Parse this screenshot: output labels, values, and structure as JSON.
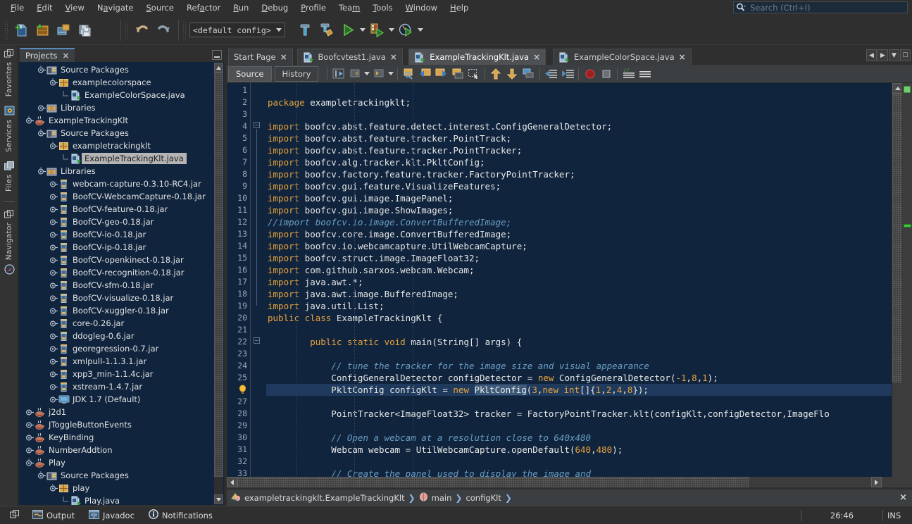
{
  "menubar": {
    "items": [
      "File",
      "Edit",
      "View",
      "Navigate",
      "Source",
      "Refactor",
      "Run",
      "Debug",
      "Profile",
      "Team",
      "Tools",
      "Window",
      "Help"
    ],
    "search_placeholder": "Search (Ctrl+I)",
    "search_value": ""
  },
  "toolbar": {
    "config_value": "<default config>",
    "buttons": [
      {
        "name": "new-file-icon",
        "tooltip": "New File"
      },
      {
        "name": "new-project-icon",
        "tooltip": "New Project"
      },
      {
        "name": "open-project-icon",
        "tooltip": "Open Project"
      },
      {
        "name": "save-all-icon",
        "tooltip": "Save All"
      },
      {
        "name": "undo-icon",
        "tooltip": "Undo"
      },
      {
        "name": "redo-icon",
        "tooltip": "Redo"
      },
      {
        "name": "build-project-icon",
        "tooltip": "Build Project"
      },
      {
        "name": "clean-build-icon",
        "tooltip": "Clean and Build Project"
      },
      {
        "name": "run-project-icon",
        "tooltip": "Run Project"
      },
      {
        "name": "debug-project-icon",
        "tooltip": "Debug Project"
      },
      {
        "name": "profile-project-icon",
        "tooltip": "Profile Project"
      }
    ]
  },
  "left_strip": {
    "items": [
      {
        "label": "Favorites",
        "icon": "favorites-icon"
      },
      {
        "label": "Services",
        "icon": "services-icon"
      },
      {
        "label": "Files",
        "icon": "files-icon"
      },
      {
        "label": "Navigator",
        "icon": "navigator-icon"
      }
    ]
  },
  "projects_panel": {
    "tab_label": "Projects",
    "tab_close": "×",
    "tree": [
      {
        "indent": 2,
        "toggle": "expanded",
        "icon": "source-packages-icon",
        "label": "Source Packages"
      },
      {
        "indent": 3,
        "toggle": "expanded",
        "icon": "package-icon",
        "label": "examplecolorspace"
      },
      {
        "indent": 4,
        "toggle": "leaf",
        "icon": "java-file-icon",
        "label": "ExampleColorSpace.java"
      },
      {
        "indent": 2,
        "toggle": "collapsed",
        "icon": "libraries-icon",
        "label": "Libraries"
      },
      {
        "indent": 1,
        "toggle": "expanded",
        "icon": "java-project-icon",
        "label": "ExampleTrackingKlt"
      },
      {
        "indent": 2,
        "toggle": "expanded",
        "icon": "source-packages-icon",
        "label": "Source Packages"
      },
      {
        "indent": 3,
        "toggle": "expanded",
        "icon": "package-icon",
        "label": "exampletrackingklt"
      },
      {
        "indent": 4,
        "toggle": "leaf",
        "icon": "java-file-icon",
        "label": "ExampleTrackingKlt.java",
        "selected": true
      },
      {
        "indent": 2,
        "toggle": "expanded",
        "icon": "libraries-icon",
        "label": "Libraries"
      },
      {
        "indent": 3,
        "toggle": "collapsed",
        "icon": "jar-icon",
        "label": "webcam-capture-0.3.10-RC4.jar"
      },
      {
        "indent": 3,
        "toggle": "collapsed",
        "icon": "jar-icon",
        "label": "BoofCV-WebcamCapture-0.18.jar"
      },
      {
        "indent": 3,
        "toggle": "collapsed",
        "icon": "jar-icon",
        "label": "BoofCV-feature-0.18.jar"
      },
      {
        "indent": 3,
        "toggle": "collapsed",
        "icon": "jar-icon",
        "label": "BoofCV-geo-0.18.jar"
      },
      {
        "indent": 3,
        "toggle": "collapsed",
        "icon": "jar-icon",
        "label": "BoofCV-io-0.18.jar"
      },
      {
        "indent": 3,
        "toggle": "collapsed",
        "icon": "jar-icon",
        "label": "BoofCV-ip-0.18.jar"
      },
      {
        "indent": 3,
        "toggle": "collapsed",
        "icon": "jar-icon",
        "label": "BoofCV-openkinect-0.18.jar"
      },
      {
        "indent": 3,
        "toggle": "collapsed",
        "icon": "jar-icon",
        "label": "BoofCV-recognition-0.18.jar"
      },
      {
        "indent": 3,
        "toggle": "collapsed",
        "icon": "jar-icon",
        "label": "BoofCV-sfm-0.18.jar"
      },
      {
        "indent": 3,
        "toggle": "collapsed",
        "icon": "jar-icon",
        "label": "BoofCV-visualize-0.18.jar"
      },
      {
        "indent": 3,
        "toggle": "collapsed",
        "icon": "jar-icon",
        "label": "BoofCV-xuggler-0.18.jar"
      },
      {
        "indent": 3,
        "toggle": "collapsed",
        "icon": "jar-icon",
        "label": "core-0.26.jar"
      },
      {
        "indent": 3,
        "toggle": "collapsed",
        "icon": "jar-icon",
        "label": "ddogleg-0.6.jar"
      },
      {
        "indent": 3,
        "toggle": "collapsed",
        "icon": "jar-icon",
        "label": "georegression-0.7.jar"
      },
      {
        "indent": 3,
        "toggle": "collapsed",
        "icon": "jar-icon",
        "label": "xmlpull-1.1.3.1.jar"
      },
      {
        "indent": 3,
        "toggle": "collapsed",
        "icon": "jar-icon",
        "label": "xpp3_min-1.1.4c.jar"
      },
      {
        "indent": 3,
        "toggle": "collapsed",
        "icon": "jar-icon",
        "label": "xstream-1.4.7.jar"
      },
      {
        "indent": 3,
        "toggle": "collapsed",
        "icon": "jdk-icon",
        "label": "JDK 1.7 (Default)"
      },
      {
        "indent": 1,
        "toggle": "collapsed",
        "icon": "java-project-icon",
        "label": "j2d1"
      },
      {
        "indent": 1,
        "toggle": "collapsed",
        "icon": "java-project-icon",
        "label": "JToggleButtonEvents"
      },
      {
        "indent": 1,
        "toggle": "collapsed",
        "icon": "java-project-icon",
        "label": "KeyBinding"
      },
      {
        "indent": 1,
        "toggle": "collapsed",
        "icon": "java-project-icon",
        "label": "NumberAddtion"
      },
      {
        "indent": 1,
        "toggle": "expanded",
        "icon": "java-project-icon",
        "label": "Play"
      },
      {
        "indent": 2,
        "toggle": "expanded",
        "icon": "source-packages-icon",
        "label": "Source Packages"
      },
      {
        "indent": 3,
        "toggle": "expanded",
        "icon": "package-icon",
        "label": "play"
      },
      {
        "indent": 4,
        "toggle": "leaf",
        "icon": "java-file-icon",
        "label": "Play.java"
      }
    ]
  },
  "editor": {
    "tabs": [
      {
        "label": "Start Page",
        "icon": null,
        "active": false,
        "close": "×"
      },
      {
        "label": "Boofcvtest1.java",
        "icon": "java-file-icon",
        "active": false,
        "close": "×"
      },
      {
        "label": "ExampleTrackingKlt.java",
        "icon": "java-file-icon",
        "active": true,
        "close": "×"
      },
      {
        "label": "ExampleColorSpace.java",
        "icon": "java-file-icon",
        "active": false,
        "close": "×"
      }
    ],
    "view_tabs": [
      {
        "label": "Source",
        "active": true
      },
      {
        "label": "History",
        "active": false
      }
    ],
    "toolbar_icons": [
      "last-edit-icon",
      "back-icon",
      "forward-icon",
      "find-selection-icon",
      "previous-bookmark-icon",
      "next-bookmark-icon",
      "toggle-bookmark-icon",
      "toggle-rectangular-selection-icon",
      "previous-error-icon",
      "next-error-icon",
      "shift-line-left-icon",
      "shift-line-right-icon",
      "start-macro-recording-icon",
      "stop-macro-recording-icon",
      "toggle-highlight-icon",
      "comment-icon"
    ],
    "breadcrumb": [
      {
        "label": "exampletrackingklt.ExampleTrackingKlt",
        "icon": "class-icon"
      },
      {
        "label": "main",
        "icon": "method-icon"
      },
      {
        "label": "configKlt",
        "icon": null
      }
    ],
    "breadcrumb_separator": "❯",
    "breadcrumb_close": "×",
    "lines": [
      {
        "n": 1,
        "text": "",
        "tokens": []
      },
      {
        "n": 2,
        "text": "package exampletrackingklt;",
        "tokens": [
          [
            "kw",
            "package"
          ],
          [
            "pl",
            " exampletrackingklt;"
          ]
        ]
      },
      {
        "n": 3,
        "text": "",
        "tokens": []
      },
      {
        "n": 4,
        "text": "import boofcv.abst.feature.detect.interest.ConfigGeneralDetector;",
        "tokens": [
          [
            "kw",
            "import"
          ],
          [
            "pl",
            " boofcv.abst.feature.detect.interest.ConfigGeneralDetector;"
          ]
        ]
      },
      {
        "n": 5,
        "text": "import boofcv.abst.feature.tracker.PointTrack;",
        "tokens": [
          [
            "kw",
            "import"
          ],
          [
            "pl",
            " boofcv.abst.feature.tracker.PointTrack;"
          ]
        ]
      },
      {
        "n": 6,
        "text": "import boofcv.abst.feature.tracker.PointTracker;",
        "tokens": [
          [
            "kw",
            "import"
          ],
          [
            "pl",
            " boofcv.abst.feature.tracker.PointTracker;"
          ]
        ]
      },
      {
        "n": 7,
        "text": "import boofcv.alg.tracker.klt.PkltConfig;",
        "tokens": [
          [
            "kw",
            "import"
          ],
          [
            "pl",
            " boofcv.alg.tracker.klt.PkltConfig;"
          ]
        ]
      },
      {
        "n": 8,
        "text": "import boofcv.factory.feature.tracker.FactoryPointTracker;",
        "tokens": [
          [
            "kw",
            "import"
          ],
          [
            "pl",
            " boofcv.factory.feature.tracker.FactoryPointTracker;"
          ]
        ]
      },
      {
        "n": 9,
        "text": "import boofcv.gui.feature.VisualizeFeatures;",
        "tokens": [
          [
            "kw",
            "import"
          ],
          [
            "pl",
            " boofcv.gui.feature.VisualizeFeatures;"
          ]
        ]
      },
      {
        "n": 10,
        "text": "import boofcv.gui.image.ImagePanel;",
        "tokens": [
          [
            "kw",
            "import"
          ],
          [
            "pl",
            " boofcv.gui.image.ImagePanel;"
          ]
        ]
      },
      {
        "n": 11,
        "text": "import boofcv.gui.image.ShowImages;",
        "tokens": [
          [
            "kw",
            "import"
          ],
          [
            "pl",
            " boofcv.gui.image.ShowImages;"
          ]
        ]
      },
      {
        "n": 12,
        "text": "//import boofcv.io.image.ConvertBufferedImage;",
        "tokens": [
          [
            "cm",
            "//import boofcv.io.image.ConvertBufferedImage;"
          ]
        ]
      },
      {
        "n": 13,
        "text": "import boofcv.core.image.ConvertBufferedImage;",
        "tokens": [
          [
            "kw",
            "import"
          ],
          [
            "pl",
            " boofcv.core.image.ConvertBufferedImage;"
          ]
        ]
      },
      {
        "n": 14,
        "text": "import boofcv.io.webcamcapture.UtilWebcamCapture;",
        "tokens": [
          [
            "kw",
            "import"
          ],
          [
            "pl",
            " boofcv.io.webcamcapture.UtilWebcamCapture;"
          ]
        ]
      },
      {
        "n": 15,
        "text": "import boofcv.struct.image.ImageFloat32;",
        "tokens": [
          [
            "kw",
            "import"
          ],
          [
            "pl",
            " boofcv.struct.image.ImageFloat32;"
          ]
        ]
      },
      {
        "n": 16,
        "text": "import com.github.sarxos.webcam.Webcam;",
        "tokens": [
          [
            "kw",
            "import"
          ],
          [
            "pl",
            " com.github.sarxos.webcam.Webcam;"
          ]
        ]
      },
      {
        "n": 17,
        "text": "import java.awt.*;",
        "tokens": [
          [
            "kw",
            "import"
          ],
          [
            "pl",
            " java.awt.*;"
          ]
        ]
      },
      {
        "n": 18,
        "text": "import java.awt.image.BufferedImage;",
        "tokens": [
          [
            "kw",
            "import"
          ],
          [
            "pl",
            " java.awt.image.BufferedImage;"
          ]
        ]
      },
      {
        "n": 19,
        "text": "import java.util.List;",
        "tokens": [
          [
            "kw",
            "import"
          ],
          [
            "pl",
            " java.util.List;"
          ]
        ]
      },
      {
        "n": 20,
        "text": "public class ExampleTrackingKlt {",
        "tokens": [
          [
            "kw",
            "public class"
          ],
          [
            "pl",
            " ExampleTrackingKlt {"
          ]
        ]
      },
      {
        "n": 21,
        "text": "",
        "tokens": []
      },
      {
        "n": 22,
        "text": "        public static void main(String[] args) {",
        "tokens": [
          [
            "pl",
            "        "
          ],
          [
            "kw",
            "public static void"
          ],
          [
            "pl",
            " main(String[] args) {"
          ]
        ]
      },
      {
        "n": 23,
        "text": "",
        "tokens": []
      },
      {
        "n": 24,
        "text": "            // tune the tracker for the image size and visual appearance",
        "tokens": [
          [
            "pl",
            "            "
          ],
          [
            "cm",
            "// tune the tracker for the image size and visual appearance"
          ]
        ]
      },
      {
        "n": 25,
        "text": "            ConfigGeneralDetector configDetector = new ConfigGeneralDetector(-1,8,1);",
        "tokens": [
          [
            "pl",
            "            ConfigGeneralDetector configDetector = "
          ],
          [
            "kw",
            "new"
          ],
          [
            "pl",
            " ConfigGeneralDetector("
          ],
          [
            "num",
            "-1"
          ],
          [
            "pl",
            ","
          ],
          [
            "num",
            "8"
          ],
          [
            "pl",
            ","
          ],
          [
            "num",
            "1"
          ],
          [
            "pl",
            ");"
          ]
        ]
      },
      {
        "n": 26,
        "text": "            PkltConfig configKlt = new PkltConfig(3,new int[]{1,2,4,8});",
        "highlighted": true,
        "has_hint": true
      },
      {
        "n": 27,
        "text": "",
        "tokens": []
      },
      {
        "n": 28,
        "text": "            PointTracker<ImageFloat32> tracker = FactoryPointTracker.klt(configKlt,configDetector,ImageFlo",
        "tokens": [
          [
            "pl",
            "            PointTracker<ImageFloat32> tracker = FactoryPointTracker.klt(configKlt,configDetector,ImageFlo"
          ]
        ]
      },
      {
        "n": 29,
        "text": "",
        "tokens": []
      },
      {
        "n": 30,
        "text": "            // Open a webcam at a resolution close to 640x480",
        "tokens": [
          [
            "pl",
            "            "
          ],
          [
            "cm",
            "// Open a webcam at a resolution close to 640x480"
          ]
        ]
      },
      {
        "n": 31,
        "text": "            Webcam webcam = UtilWebcamCapture.openDefault(640,480);",
        "tokens": [
          [
            "pl",
            "            Webcam webcam = UtilWebcamCapture.openDefault("
          ],
          [
            "num",
            "640"
          ],
          [
            "pl",
            ","
          ],
          [
            "num",
            "480"
          ],
          [
            "pl",
            ");"
          ]
        ]
      },
      {
        "n": 32,
        "text": "",
        "tokens": []
      },
      {
        "n": 33,
        "text": "            // Create the panel used to display the image and",
        "tokens": [
          [
            "pl",
            "            "
          ],
          [
            "cm",
            "// Create the panel used to display the image and"
          ]
        ]
      }
    ],
    "highlighted_line_parts": {
      "indent": "            ",
      "pre": "PkltConfig configKlt = ",
      "kw_new": "new",
      "sel_a": "Pk",
      "sel_b": "ltConfig",
      "open_paren": "(",
      "num3": "3",
      "comma": ",",
      "kw_new2": "new",
      "int_decl": " int[]{",
      "n1": "1",
      "n2": "2",
      "n4": "4",
      "n8": "8",
      "tail": "});"
    }
  },
  "statusbar": {
    "left_items": [
      {
        "label": "Output",
        "icon": "output-icon"
      },
      {
        "label": "Javadoc",
        "icon": "javadoc-icon"
      },
      {
        "label": "Notifications",
        "icon": "notifications-icon"
      }
    ],
    "windows_icon": "windows-icon",
    "position": "26:46",
    "insert_mode": "INS"
  },
  "colors": {
    "editor_bg": "#10243d",
    "panel_bg": "#2f2f2f",
    "tree_bg": "#10243d",
    "keyword": "#e8a33d",
    "comment": "#6a9ec5",
    "accent": "#5a8ac0",
    "highlight_line": "#1f3a5c"
  }
}
